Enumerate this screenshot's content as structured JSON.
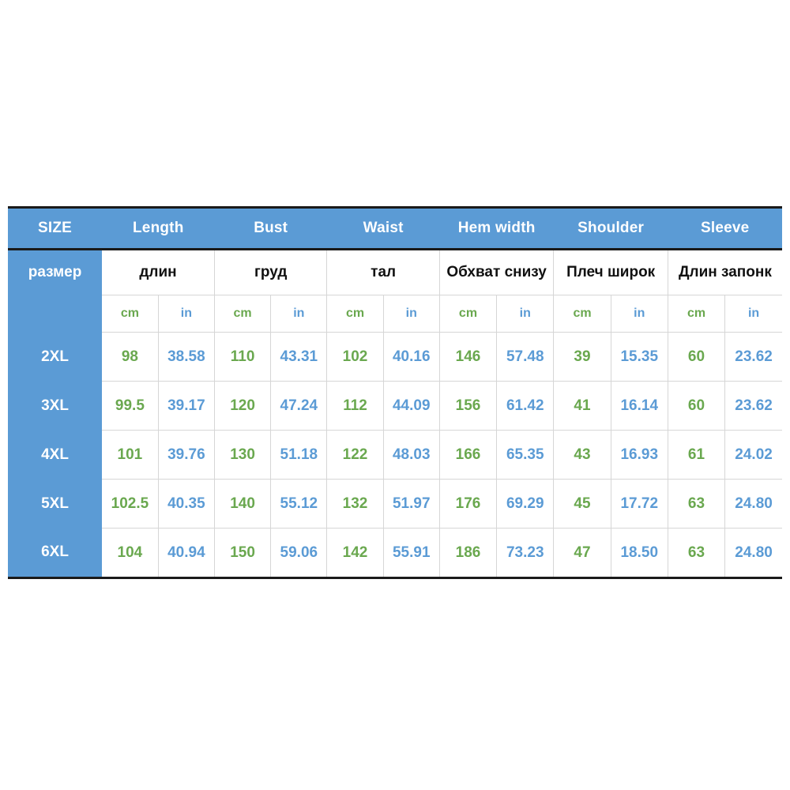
{
  "table": {
    "size_column": {
      "header_en": "SIZE",
      "header_ru": "размер"
    },
    "measurements": [
      {
        "en": "Length",
        "ru": "длин"
      },
      {
        "en": "Bust",
        "ru": "груд"
      },
      {
        "en": "Waist",
        "ru": "тал"
      },
      {
        "en": "Hem width",
        "ru": "Обхват снизу"
      },
      {
        "en": "Shoulder",
        "ru": "Плеч широк"
      },
      {
        "en": "Sleeve",
        "ru": "Длин запонк"
      }
    ],
    "units": {
      "cm": "cm",
      "in": "in"
    },
    "colors": {
      "header_blue": "#5b9bd5",
      "cm_green": "#6aa84f",
      "in_blue": "#5b9bd5",
      "border_dark": "#1a1a1a",
      "grid_line": "#d6d6d6"
    },
    "rows": [
      {
        "size": "2XL",
        "values": [
          "98",
          "38.58",
          "110",
          "43.31",
          "102",
          "40.16",
          "146",
          "57.48",
          "39",
          "15.35",
          "60",
          "23.62"
        ]
      },
      {
        "size": "3XL",
        "values": [
          "99.5",
          "39.17",
          "120",
          "47.24",
          "112",
          "44.09",
          "156",
          "61.42",
          "41",
          "16.14",
          "60",
          "23.62"
        ]
      },
      {
        "size": "4XL",
        "values": [
          "101",
          "39.76",
          "130",
          "51.18",
          "122",
          "48.03",
          "166",
          "65.35",
          "43",
          "16.93",
          "61",
          "24.02"
        ]
      },
      {
        "size": "5XL",
        "values": [
          "102.5",
          "40.35",
          "140",
          "55.12",
          "132",
          "51.97",
          "176",
          "69.29",
          "45",
          "17.72",
          "63",
          "24.80"
        ]
      },
      {
        "size": "6XL",
        "values": [
          "104",
          "40.94",
          "150",
          "59.06",
          "142",
          "55.91",
          "186",
          "73.23",
          "47",
          "18.50",
          "63",
          "24.80"
        ]
      }
    ]
  }
}
